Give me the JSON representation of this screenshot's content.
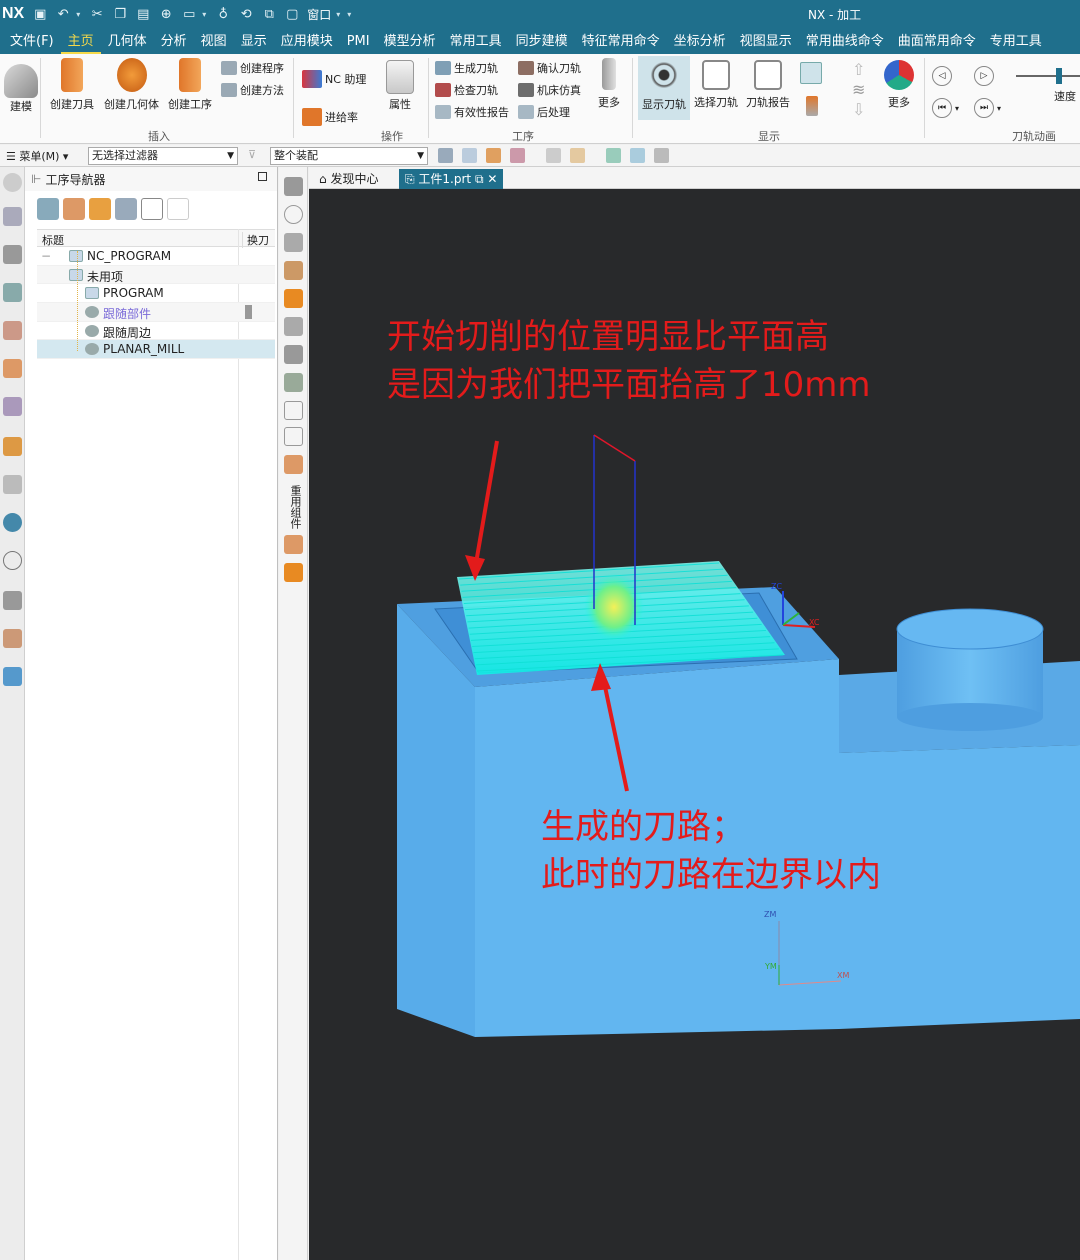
{
  "app": {
    "logo": "NX",
    "title": "NX - 加工",
    "window_menu": "窗口"
  },
  "tabs": [
    "文件(F)",
    "主页",
    "几何体",
    "分析",
    "视图",
    "显示",
    "应用模块",
    "PMI",
    "模型分析",
    "常用工具",
    "同步建模",
    "特征常用命令",
    "坐标分析",
    "视图显示",
    "常用曲线命令",
    "曲面常用命令",
    "专用工具"
  ],
  "ribbon": {
    "build": "建模",
    "create_tool": "创建刀具",
    "create_geometry": "创建几何体",
    "create_operation": "创建工序",
    "create_program": "创建程序",
    "create_method": "创建方法",
    "insert_group": "插入",
    "nc_assist": "NC 助理",
    "feed_rate": "进给率",
    "properties": "属性",
    "operation_group": "操作",
    "generate_toolpath": "生成刀轨",
    "verify_toolpath": "确认刀轨",
    "check_toolpath": "检查刀轨",
    "machine_sim": "机床仿真",
    "validity_report": "有效性报告",
    "post_process": "后处理",
    "more": "更多",
    "process_group": "工序",
    "show_toolpath": "显示刀轨",
    "select_toolpath": "选择刀轨",
    "toolpath_report": "刀轨报告",
    "display_group": "显示",
    "more2": "更多",
    "speed": "速度",
    "animation_group": "刀轨动画"
  },
  "toolbar2": {
    "menu": "菜单(M)",
    "filter": "无选择过滤器",
    "assembly": "整个装配"
  },
  "navigator": {
    "title": "工序导航器",
    "col_title": "标题",
    "col_tool": "换刀",
    "rows": [
      {
        "label": "NC_PROGRAM",
        "indent": 0
      },
      {
        "label": "未用项",
        "indent": 1
      },
      {
        "label": "PROGRAM",
        "indent": 2
      },
      {
        "label": "跟随部件",
        "indent": 2
      },
      {
        "label": "跟随周边",
        "indent": 2
      },
      {
        "label": "PLANAR_MILL",
        "indent": 2
      }
    ]
  },
  "vertical_label": "重用组件",
  "doc_tabs": {
    "discovery": "发现中心",
    "part": "工件1.prt"
  },
  "axes": {
    "zc": "ZC",
    "xc": "XC",
    "zm": "ZM",
    "ym": "YM",
    "xm": "XM"
  },
  "annotations": {
    "top_line1": "开始切削的位置明显比平面高",
    "top_line2": "是因为我们把平面抬高了10mm",
    "bottom_line1": "生成的刀路；",
    "bottom_line2": "此时的刀路在边界以内"
  },
  "colors": {
    "titlebar": "#1f6f8c",
    "viewport_bg": "#28292b",
    "part_blue": "#5fb4ee",
    "toolpath_cyan": "#1ef3e6",
    "annotation_red": "#e31b1b"
  }
}
